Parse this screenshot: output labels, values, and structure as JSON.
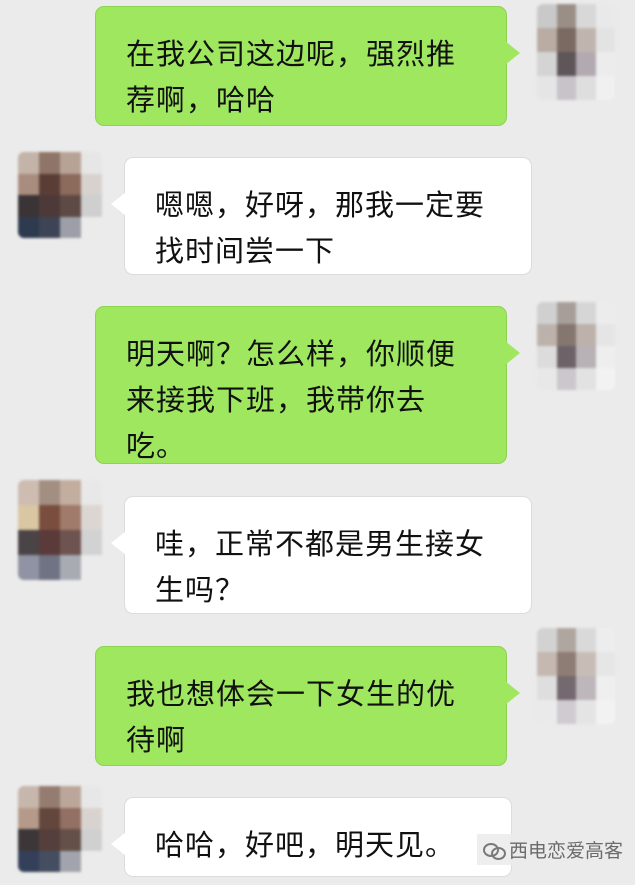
{
  "messages": [
    {
      "side": "sent",
      "text": "在我公司这边呢，强烈推荐啊，哈哈"
    },
    {
      "side": "recv",
      "text": "嗯嗯，好呀，那我一定要找时间尝一下"
    },
    {
      "side": "sent",
      "text": "明天啊？怎么样，你顺便来接我下班，我带你去吃。"
    },
    {
      "side": "recv",
      "text": "哇，正常不都是男生接女生吗？"
    },
    {
      "side": "sent",
      "text": "我也想体会一下女生的优待啊"
    },
    {
      "side": "recv",
      "text": "哈哈，好吧，明天见。"
    }
  ],
  "watermark": {
    "text": "西电恋爱高客",
    "icon": "wechat-logo-icon"
  },
  "colors": {
    "background": "#ebebeb",
    "sent_bubble": "#9fe75f",
    "received_bubble": "#ffffff"
  }
}
